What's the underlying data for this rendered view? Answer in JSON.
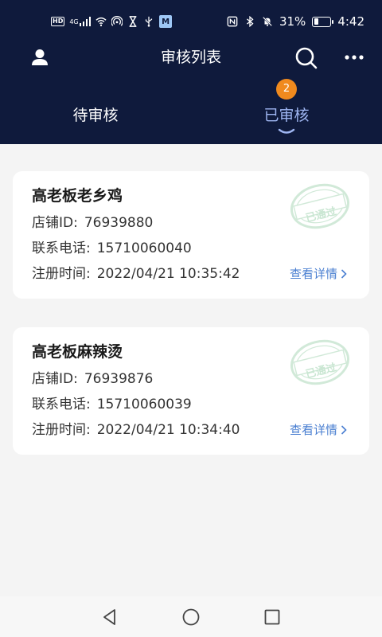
{
  "status_bar": {
    "network_type": "4G",
    "hd_label": "HD",
    "app_badge": "M",
    "battery_percent": "31%",
    "battery_level": 0.31,
    "time": "4:42"
  },
  "header": {
    "title": "审核列表"
  },
  "tabs": [
    {
      "label": "待审核",
      "active": false
    },
    {
      "label": "已审核",
      "active": true,
      "badge": "2"
    }
  ],
  "records": [
    {
      "store_name": "高老板老乡鸡",
      "store_id_label": "店铺ID:",
      "store_id": "76939880",
      "phone_label": "联系电话:",
      "phone": "15710060040",
      "register_label": "注册时间:",
      "register_time": "2022/04/21 10:35:42",
      "detail_link": "查看详情",
      "stamp_text": "已通过"
    },
    {
      "store_name": "高老板麻辣烫",
      "store_id_label": "店铺ID:",
      "store_id": "76939876",
      "phone_label": "联系电话:",
      "phone": "15710060039",
      "register_label": "注册时间:",
      "register_time": "2022/04/21 10:34:40",
      "detail_link": "查看详情",
      "stamp_text": "已通过"
    }
  ],
  "colors": {
    "header_bg": "#0f1a3c",
    "active_tab": "#9fb6f2",
    "badge": "#f08a1e",
    "link": "#4a7fd1",
    "stamp": "#c9e6d2"
  },
  "icons": {
    "user": "user-icon",
    "search": "search-icon",
    "more": "more-icon",
    "chevron": "chevron-right-icon",
    "back": "back-triangle-icon",
    "home": "home-circle-icon",
    "recent": "recent-square-icon"
  }
}
